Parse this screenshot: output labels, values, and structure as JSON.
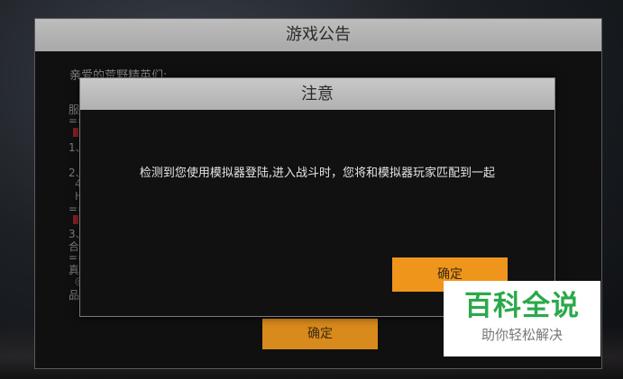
{
  "announcement": {
    "title": "游戏公告",
    "greeting": "亲爱的荒野精英们:",
    "fragments": [
      "服",
      "==",
      "1、",
      "2、",
      "4",
      "H",
      "==",
      "3、",
      "合",
      "==",
      "真",
      "◎",
      "品"
    ],
    "confirm_label": "确定"
  },
  "notice": {
    "title": "注意",
    "message": "检测到您使用模拟器登陆,进入战斗时，您将和模拟器玩家匹配到一起",
    "confirm_label": "确定"
  },
  "watermark": {
    "main": "百科全说",
    "sub": "助你轻松解决"
  },
  "colors": {
    "accent_orange": "#f0951c",
    "watermark_green": "#2aa94a"
  }
}
